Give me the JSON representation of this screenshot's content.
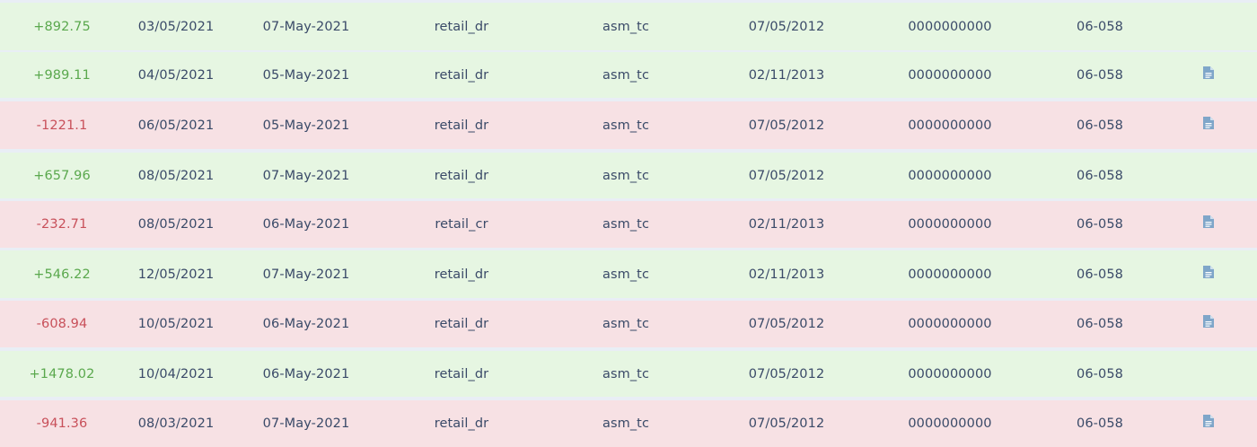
{
  "colors": {
    "credit_row_bg": "#e6f6e2",
    "debit_row_bg": "#f7e1e4",
    "positive_amount": "#5aa84d",
    "negative_amount": "#c8505a",
    "text": "#3a4a68",
    "doc_icon": "#7fa6c9"
  },
  "icons": {
    "document": "document-icon"
  },
  "rows": [
    {
      "amount": "+892.75",
      "sign": "pos",
      "date1": "03/05/2021",
      "date2": "07-May-2021",
      "type": "retail_dr",
      "user": "asm_tc",
      "date3": "07/05/2012",
      "account": "0000000000",
      "code": "06-058",
      "has_doc": false
    },
    {
      "amount": "+989.11",
      "sign": "pos",
      "date1": "04/05/2021",
      "date2": "05-May-2021",
      "type": "retail_dr",
      "user": "asm_tc",
      "date3": "02/11/2013",
      "account": "0000000000",
      "code": "06-058",
      "has_doc": true
    },
    {
      "amount": "-1221.1",
      "sign": "neg",
      "date1": "06/05/2021",
      "date2": "05-May-2021",
      "type": "retail_dr",
      "user": "asm_tc",
      "date3": "07/05/2012",
      "account": "0000000000",
      "code": "06-058",
      "has_doc": true
    },
    {
      "amount": "+657.96",
      "sign": "pos",
      "date1": "08/05/2021",
      "date2": "07-May-2021",
      "type": "retail_dr",
      "user": "asm_tc",
      "date3": "07/05/2012",
      "account": "0000000000",
      "code": "06-058",
      "has_doc": false
    },
    {
      "amount": "-232.71",
      "sign": "neg",
      "date1": "08/05/2021",
      "date2": "06-May-2021",
      "type": "retail_cr",
      "user": "asm_tc",
      "date3": "02/11/2013",
      "account": "0000000000",
      "code": "06-058",
      "has_doc": true
    },
    {
      "amount": "+546.22",
      "sign": "pos",
      "date1": "12/05/2021",
      "date2": "07-May-2021",
      "type": "retail_dr",
      "user": "asm_tc",
      "date3": "02/11/2013",
      "account": "0000000000",
      "code": "06-058",
      "has_doc": true
    },
    {
      "amount": "-608.94",
      "sign": "neg",
      "date1": "10/05/2021",
      "date2": "06-May-2021",
      "type": "retail_dr",
      "user": "asm_tc",
      "date3": "07/05/2012",
      "account": "0000000000",
      "code": "06-058",
      "has_doc": true
    },
    {
      "amount": "+1478.02",
      "sign": "pos",
      "date1": "10/04/2021",
      "date2": "06-May-2021",
      "type": "retail_dr",
      "user": "asm_tc",
      "date3": "07/05/2012",
      "account": "0000000000",
      "code": "06-058",
      "has_doc": false
    },
    {
      "amount": "-941.36",
      "sign": "neg",
      "date1": "08/03/2021",
      "date2": "07-May-2021",
      "type": "retail_dr",
      "user": "asm_tc",
      "date3": "07/05/2012",
      "account": "0000000000",
      "code": "06-058",
      "has_doc": true
    }
  ]
}
